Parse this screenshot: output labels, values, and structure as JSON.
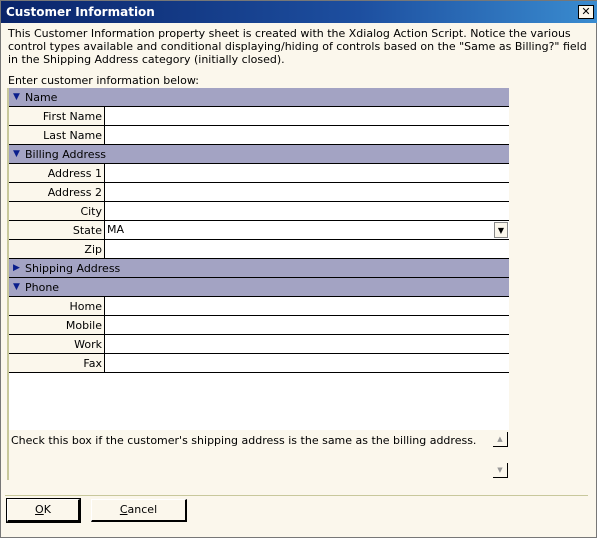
{
  "window": {
    "title": "Customer Information",
    "close": "✕"
  },
  "description": "This Customer Information property sheet is created with the Xdialog Action Script.  Notice the various control types available and conditional displaying/hiding of controls based on the \"Same as Billing?\" field in the Shipping Address category (initially closed).",
  "prompt": "Enter customer information below:",
  "categories": {
    "name": {
      "label": "Name",
      "fields": [
        {
          "label": "First Name",
          "value": ""
        },
        {
          "label": "Last Name",
          "value": ""
        }
      ]
    },
    "billing": {
      "label": "Billing Address",
      "fields": [
        {
          "label": "Address 1",
          "value": ""
        },
        {
          "label": "Address 2",
          "value": ""
        },
        {
          "label": "City",
          "value": ""
        },
        {
          "label": "State",
          "value": "MA"
        },
        {
          "label": "Zip",
          "value": ""
        }
      ]
    },
    "shipping": {
      "label": "Shipping Address"
    },
    "phone": {
      "label": "Phone",
      "fields": [
        {
          "label": "Home",
          "value": ""
        },
        {
          "label": "Mobile",
          "value": ""
        },
        {
          "label": "Work",
          "value": ""
        },
        {
          "label": "Fax",
          "value": ""
        }
      ]
    }
  },
  "help": "Check this box if the customer's shipping address is the same as the billing address.",
  "buttons": {
    "ok_underline": "O",
    "ok_rest": "K",
    "cancel_underline": "C",
    "cancel_rest": "ancel"
  }
}
